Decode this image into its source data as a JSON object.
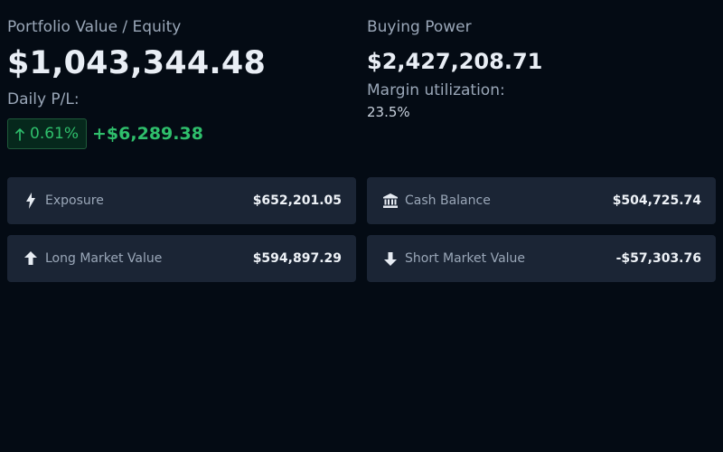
{
  "equity": {
    "label": "Portfolio Value / Equity",
    "value": "$1,043,344.48"
  },
  "daily_pl": {
    "label": "Daily P/L:",
    "percent": "0.61%",
    "amount": "+$6,289.38",
    "direction_icon": "arrow-up-icon",
    "color": "#2fbf6c"
  },
  "buying_power": {
    "label": "Buying Power",
    "value": "$2,427,208.71"
  },
  "margin": {
    "label": "Margin utilization:",
    "value": "23.5%"
  },
  "cards": {
    "exposure": {
      "label": "Exposure",
      "value": "$652,201.05",
      "icon": "lightning-icon"
    },
    "cash": {
      "label": "Cash Balance",
      "value": "$504,725.74",
      "icon": "bank-icon"
    },
    "long": {
      "label": "Long Market Value",
      "value": "$594,897.29",
      "icon": "arrow-up-icon"
    },
    "short": {
      "label": "Short Market Value",
      "value": "-$57,303.76",
      "icon": "arrow-down-icon"
    }
  },
  "colors": {
    "background": "#040b14",
    "card": "#1b2535",
    "positive": "#2fbf6c"
  }
}
